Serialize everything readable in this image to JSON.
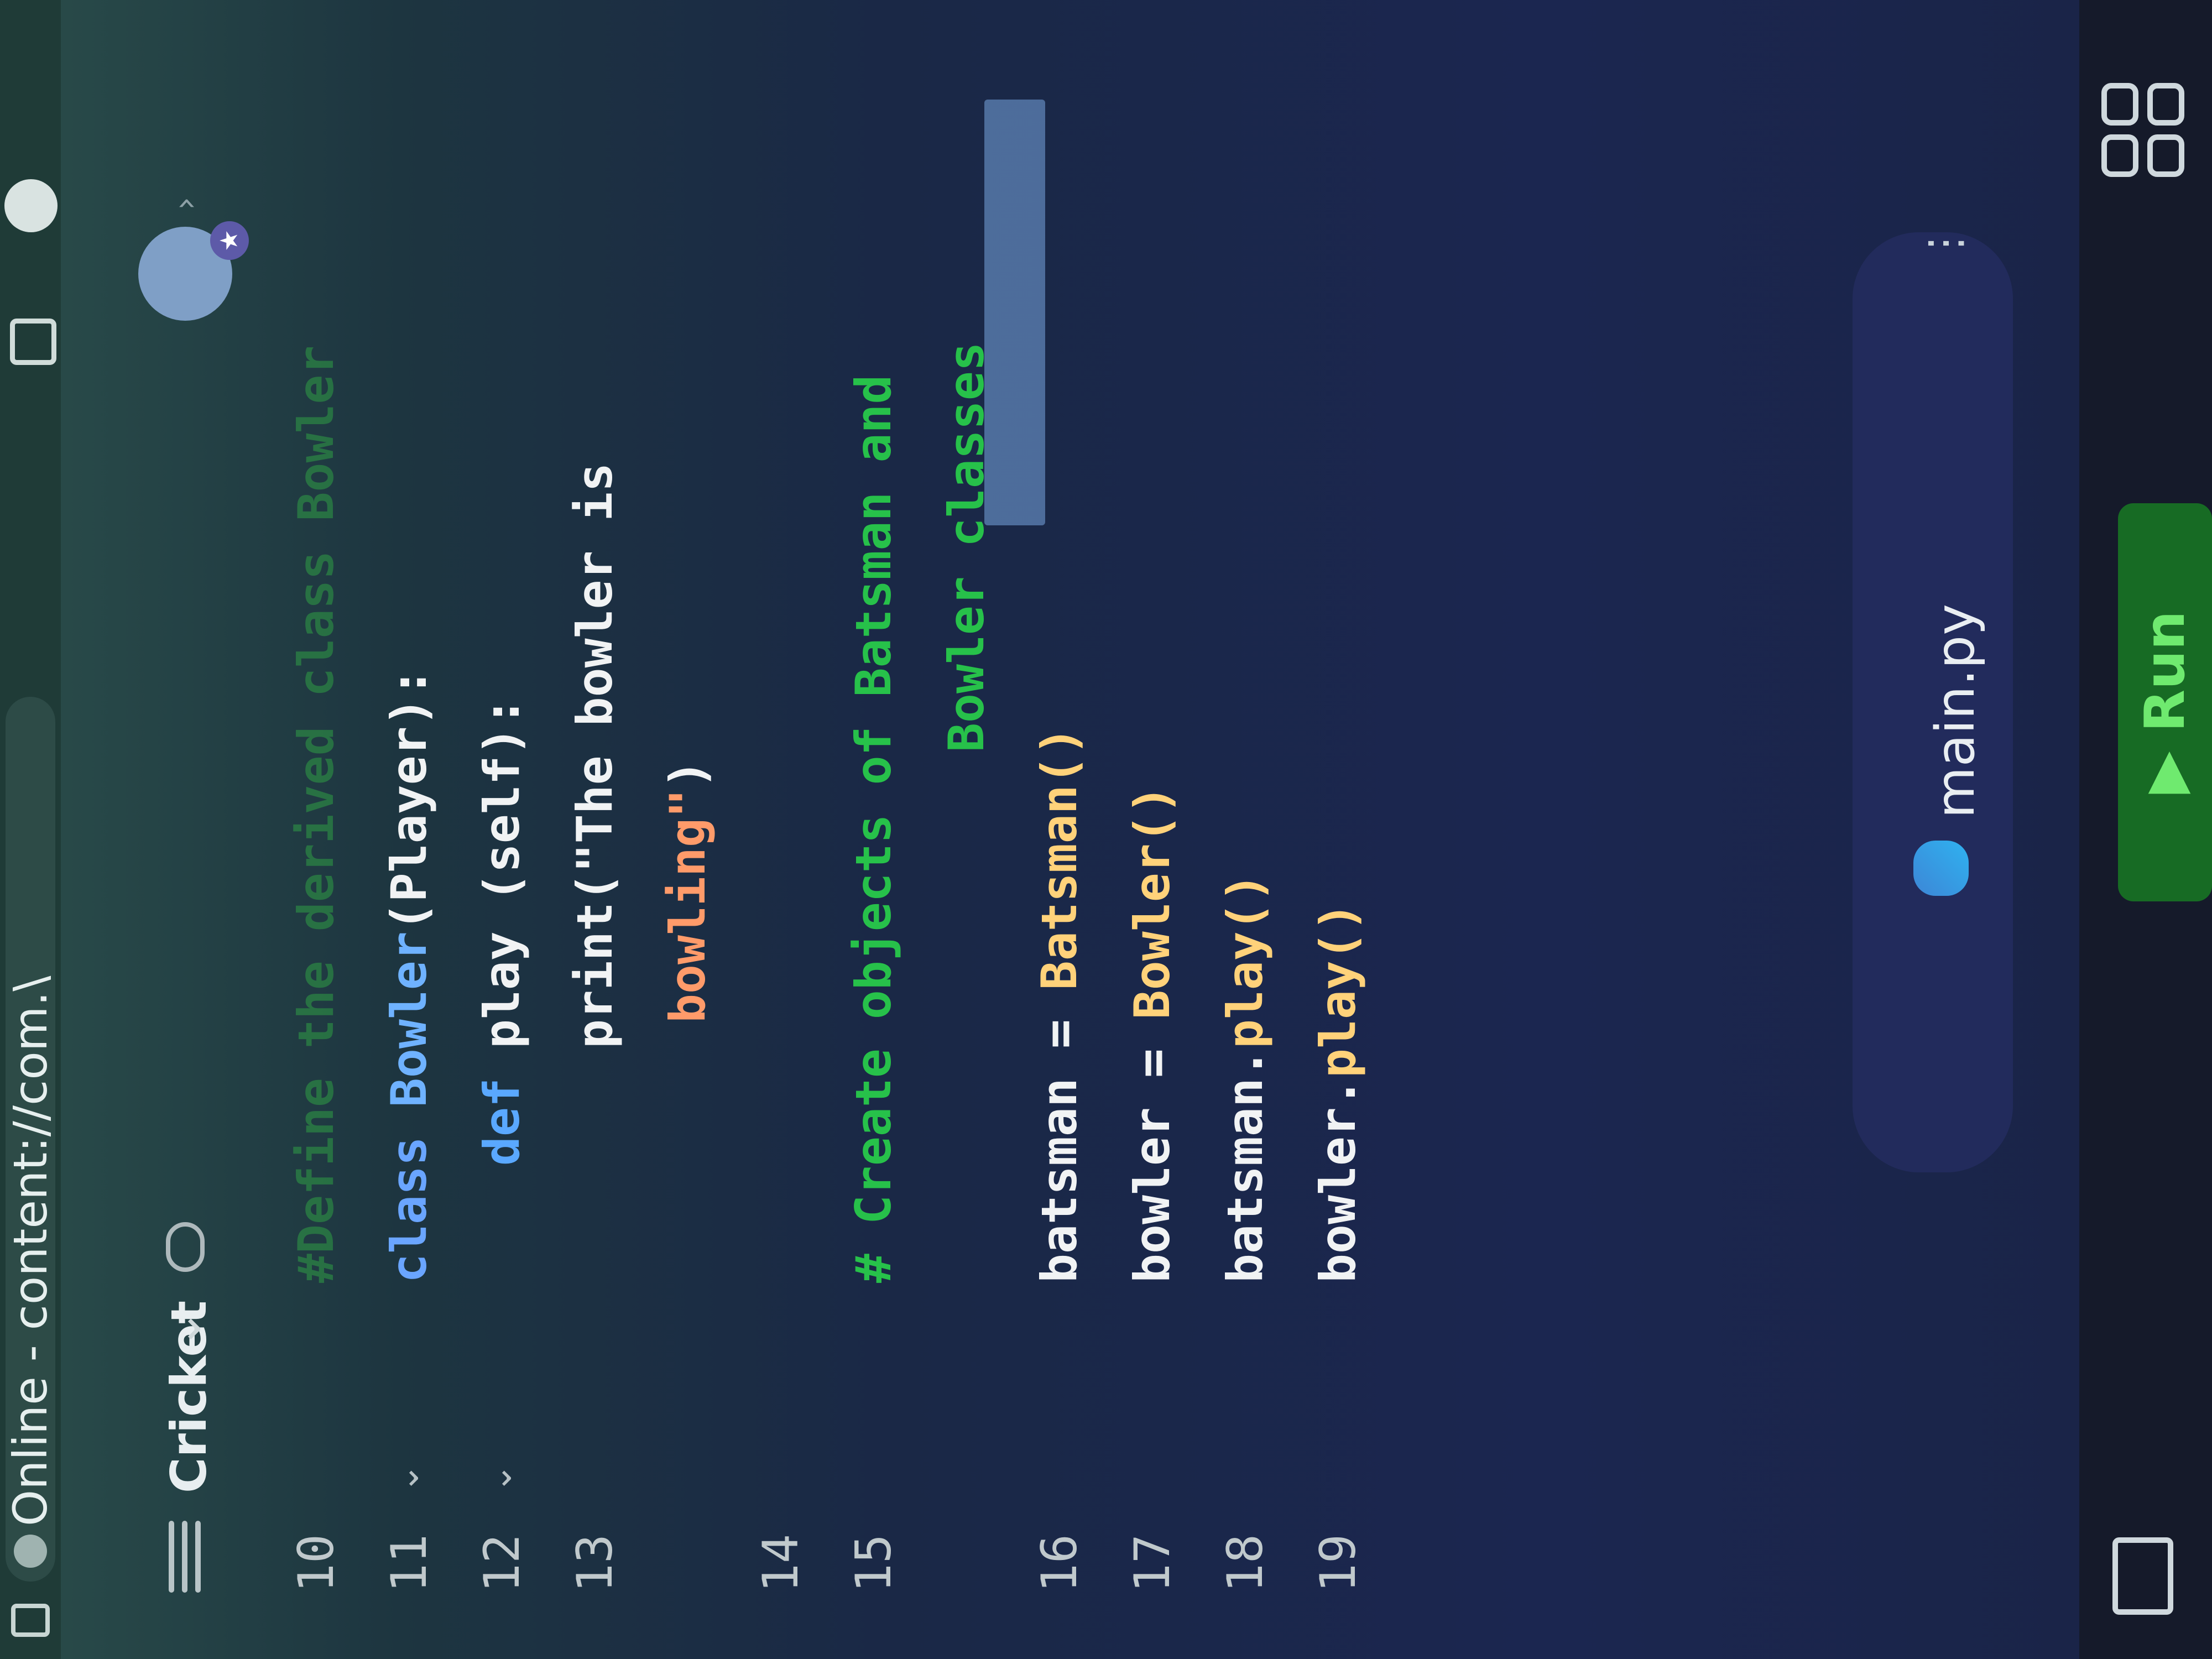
{
  "browser": {
    "url_text": "Online - content://com.\\"
  },
  "header": {
    "project_title": "Cricket"
  },
  "editor": {
    "lines": [
      {
        "n": "10",
        "tokens": [
          {
            "t": "#Define the derived class Bowler",
            "c": "faint"
          }
        ]
      },
      {
        "n": "11",
        "fold": true,
        "tokens": [
          {
            "t": "class ",
            "c": "kw"
          },
          {
            "t": "Bowler",
            "c": "cls"
          },
          {
            "t": "(Player):",
            "c": "txt"
          }
        ]
      },
      {
        "n": "12",
        "fold": true,
        "tokens": [
          {
            "t": "    def ",
            "c": "def"
          },
          {
            "t": "play (self):",
            "c": "txt"
          }
        ]
      },
      {
        "n": "13",
        "tokens": [
          {
            "t": "        print(",
            "c": "txt"
          },
          {
            "t": "\"The bowler is",
            "c": "txt"
          }
        ]
      },
      {
        "n": "",
        "tokens": [
          {
            "t": "bowling\"",
            "c": "str"
          },
          {
            "t": ")",
            "c": "txt"
          }
        ]
      },
      {
        "n": "14",
        "tokens": []
      },
      {
        "n": "15",
        "tokens": [
          {
            "t": "# Create objects of Batsman and",
            "c": "cmt"
          }
        ]
      },
      {
        "n": "",
        "tokens": [
          {
            "t": "Bowler classes",
            "c": "cmt"
          }
        ]
      },
      {
        "n": "16",
        "tokens": [
          {
            "t": "batsman = ",
            "c": "txt"
          },
          {
            "t": "Batsman()",
            "c": "fn"
          }
        ]
      },
      {
        "n": "17",
        "tokens": [
          {
            "t": "bowler = ",
            "c": "txt"
          },
          {
            "t": "Bowler()",
            "c": "fn"
          }
        ]
      },
      {
        "n": "18",
        "tokens": [
          {
            "t": "batsman.",
            "c": "txt"
          },
          {
            "t": "play()",
            "c": "fn"
          }
        ]
      },
      {
        "n": "19",
        "tokens": [
          {
            "t": "bowler.",
            "c": "txt"
          },
          {
            "t": "play()",
            "c": "fn"
          }
        ]
      }
    ]
  },
  "footer": {
    "file_name": "main.py",
    "more_label": "⋮",
    "run_label": "▶ Run"
  },
  "colors": {
    "run_green": "#176b24",
    "keyword_blue": "#6aa5ff",
    "comment_green": "#27c14a",
    "string_orange": "#ff9b6a",
    "call_yellow": "#ffd27a"
  }
}
